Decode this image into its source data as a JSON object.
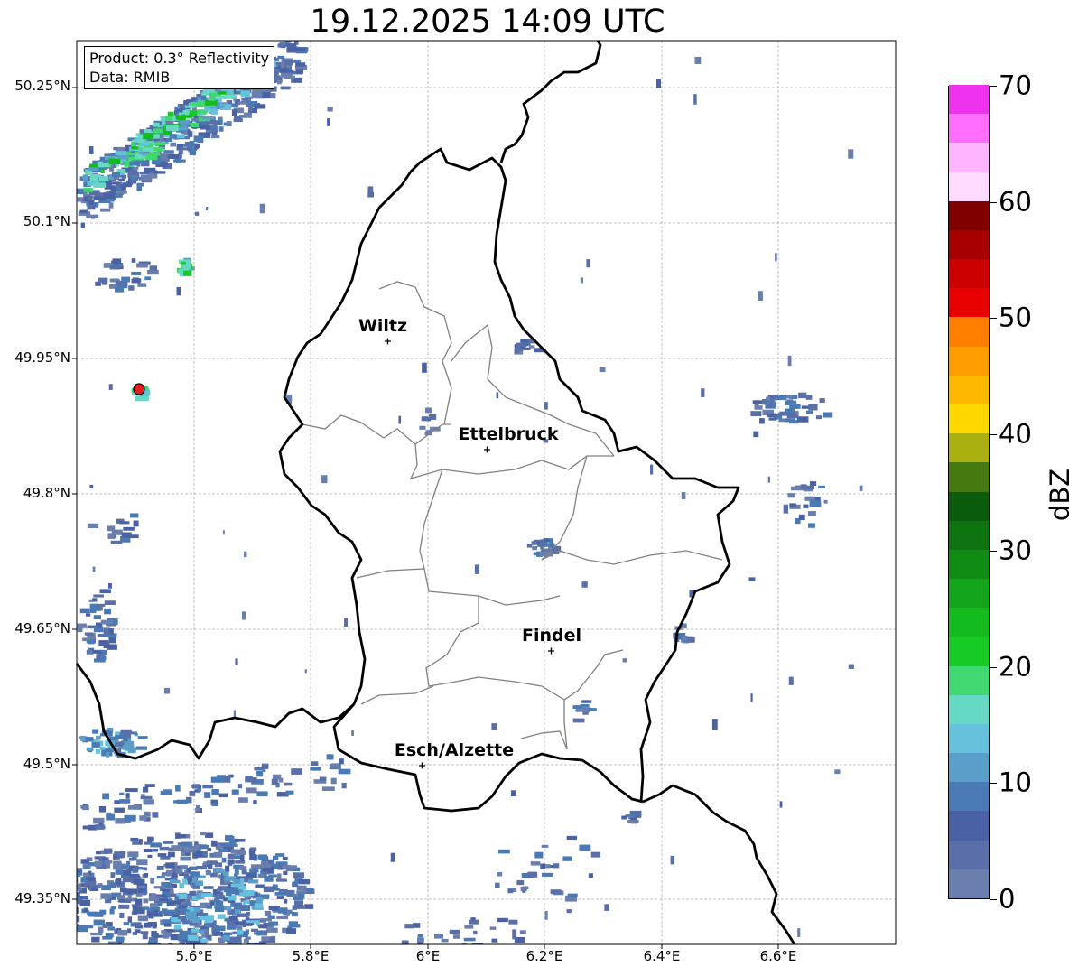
{
  "title": "19.12.2025 14:09 UTC",
  "info": {
    "product": "Product: 0.3° Reflectivity",
    "data": "Data: RMIB"
  },
  "colors": {
    "border": "#000000",
    "cantons": "#808080",
    "grid": "#b0b0b0",
    "marker": "#e02020"
  },
  "axes": {
    "lat_ticks": [
      "50.25°N",
      "50.1°N",
      "49.95°N",
      "49.8°N",
      "49.65°N",
      "49.5°N",
      "49.35°N"
    ],
    "lon_ticks": [
      "5.6°E",
      "5.8°E",
      "6°E",
      "6.2°E",
      "6.4°E",
      "6.6°E"
    ]
  },
  "cities": [
    {
      "name": "Wiltz"
    },
    {
      "name": "Ettelbruck"
    },
    {
      "name": "Findel"
    },
    {
      "name": "Esch/Alzette"
    }
  ],
  "colorbar": {
    "label": "dBZ",
    "ticks": [
      "0",
      "10",
      "20",
      "30",
      "40",
      "50",
      "60",
      "70"
    ],
    "range": [
      0,
      70
    ],
    "step": 2.5,
    "palette": [
      "#6a7fad",
      "#5a6fa8",
      "#4a62a4",
      "#4a7ab4",
      "#5a9fca",
      "#66c2dc",
      "#66d9c4",
      "#40d870",
      "#16cc24",
      "#14bb1e",
      "#12a41a",
      "#108c14",
      "#0e7410",
      "#0a5c0c",
      "#447a10",
      "#aab010",
      "#ffd800",
      "#ffb800",
      "#ff9c00",
      "#ff7e00",
      "#e80000",
      "#cc0000",
      "#a80000",
      "#800000",
      "#ffdcff",
      "#ffb4ff",
      "#ff6eff",
      "#ee32ee"
    ]
  }
}
